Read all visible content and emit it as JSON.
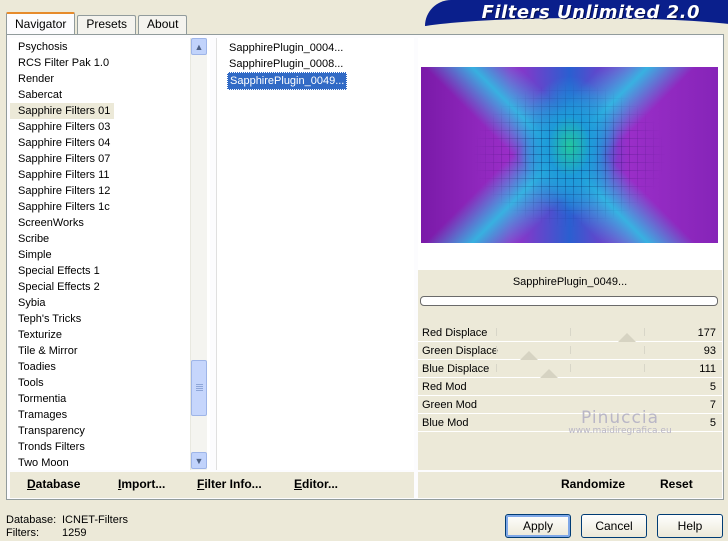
{
  "tabs": [
    {
      "label": "Navigator",
      "active": true
    },
    {
      "label": "Presets",
      "active": false
    },
    {
      "label": "About",
      "active": false
    }
  ],
  "banner_title": "Filters Unlimited 2.0",
  "categories": {
    "items": [
      "Psychosis",
      "RCS Filter Pak 1.0",
      "Render",
      "Sabercat",
      "Sapphire Filters 01",
      "Sapphire Filters 03",
      "Sapphire Filters 04",
      "Sapphire Filters 07",
      "Sapphire Filters 11",
      "Sapphire Filters 12",
      "Sapphire Filters 1c",
      "ScreenWorks",
      "Scribe",
      "Simple",
      "Special Effects 1",
      "Special Effects 2",
      "Sybia",
      "Teph's Tricks",
      "Texturize",
      "Tile & Mirror",
      "Toadies",
      "Tools",
      "Tormentia",
      "Tramages",
      "Transparency",
      "Tronds Filters",
      "Two Moon"
    ],
    "selected": "Sapphire Filters 01"
  },
  "filters": {
    "items": [
      "SapphirePlugin_0004...",
      "SapphirePlugin_0008...",
      "SapphirePlugin_0049..."
    ],
    "selected": "SapphirePlugin_0049..."
  },
  "preview": {
    "filter_name": "SapphirePlugin_0049...",
    "progress": 0
  },
  "params": [
    {
      "label": "Red Displace",
      "value": "177"
    },
    {
      "label": "Green Displace",
      "value": "93"
    },
    {
      "label": "Blue Displace",
      "value": "111"
    },
    {
      "label": "Red Mod",
      "value": "5"
    },
    {
      "label": "Green Mod",
      "value": "7"
    },
    {
      "label": "Blue Mod",
      "value": "5"
    }
  ],
  "watermark": {
    "name": "Pinuccia",
    "url": "www.maidiregrafica.eu"
  },
  "bottom_links": {
    "database": "Database",
    "import": "Import...",
    "filter_info": "Filter Info...",
    "editor": "Editor...",
    "randomize": "Randomize",
    "reset": "Reset"
  },
  "info": {
    "database_label": "Database:",
    "database_value": "ICNET-Filters",
    "filters_label": "Filters:",
    "filters_value": "1259"
  },
  "buttons": {
    "apply": "Apply",
    "cancel": "Cancel",
    "help": "Help"
  }
}
